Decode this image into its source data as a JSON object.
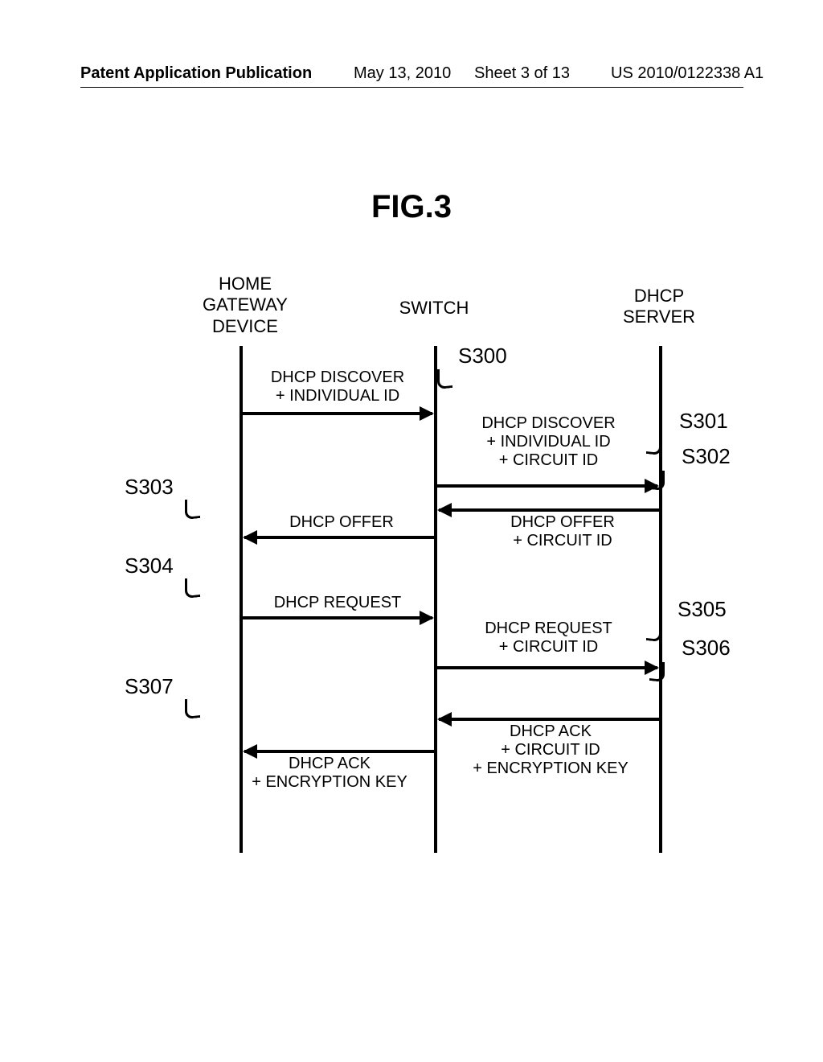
{
  "header": {
    "left": "Patent Application Publication",
    "date": "May 13, 2010",
    "sheet": "Sheet 3 of 13",
    "pubnum": "US 2010/0122338 A1"
  },
  "figure_title": "FIG.3",
  "actors": {
    "a1": "HOME\nGATEWAY\nDEVICE",
    "a2": "SWITCH",
    "a3": "DHCP\nSERVER"
  },
  "messages": {
    "m_s300": "DHCP DISCOVER\n+ INDIVIDUAL ID",
    "m_s301": "DHCP DISCOVER\n+ INDIVIDUAL ID\n+ CIRCUIT ID",
    "m_s302": "DHCP OFFER\n+ CIRCUIT ID",
    "m_s303": "DHCP OFFER",
    "m_s304": "DHCP REQUEST",
    "m_s305": "DHCP REQUEST\n+ CIRCUIT ID",
    "m_s306": "DHCP ACK\n+ CIRCUIT ID\n+ ENCRYPTION KEY",
    "m_s307": "DHCP ACK\n+ ENCRYPTION KEY"
  },
  "steps": {
    "s300": "S300",
    "s301": "S301",
    "s302": "S302",
    "s303": "S303",
    "s304": "S304",
    "s305": "S305",
    "s306": "S306",
    "s307": "S307"
  }
}
